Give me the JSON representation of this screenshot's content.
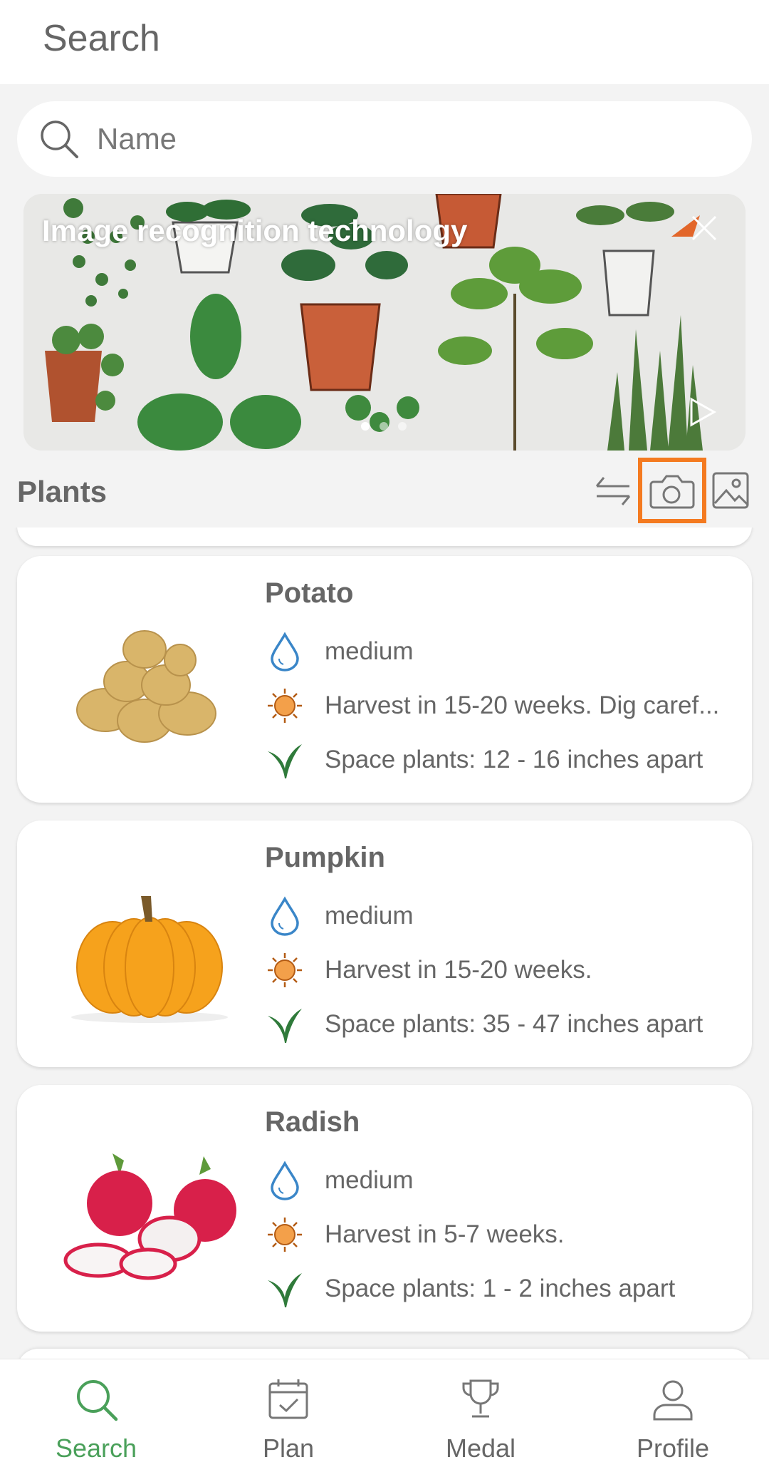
{
  "header": {
    "title": "Search"
  },
  "search": {
    "placeholder": "Name",
    "value": ""
  },
  "banner": {
    "title": "Image recognition technology",
    "slide_count": 3,
    "active_slide": 1
  },
  "plants_section": {
    "label": "Plants",
    "actions": [
      "sort-icon",
      "camera-icon",
      "gallery-icon"
    ],
    "highlight_color": "#f47a20"
  },
  "plants": [
    {
      "name": "Potato",
      "water": "medium",
      "harvest": "Harvest in 15-20 weeks. Dig caref...",
      "spacing": "Space plants: 12 - 16 inches apart"
    },
    {
      "name": "Pumpkin",
      "water": "medium",
      "harvest": "Harvest in 15-20 weeks.",
      "spacing": "Space plants: 35 - 47 inches apart"
    },
    {
      "name": "Radish",
      "water": "medium",
      "harvest": "Harvest in 5-7 weeks.",
      "spacing": "Space plants: 1 - 2 inches apart"
    }
  ],
  "nav": {
    "items": [
      {
        "label": "Search",
        "icon": "search-icon",
        "active": true
      },
      {
        "label": "Plan",
        "icon": "calendar-check-icon",
        "active": false
      },
      {
        "label": "Medal",
        "icon": "trophy-icon",
        "active": false
      },
      {
        "label": "Profile",
        "icon": "person-icon",
        "active": false
      }
    ],
    "active_color": "#4aa05a"
  },
  "colors": {
    "water_icon": "#3a86c8",
    "sun_icon": "#e08a22",
    "sprout_icon": "#2f7a3a"
  }
}
